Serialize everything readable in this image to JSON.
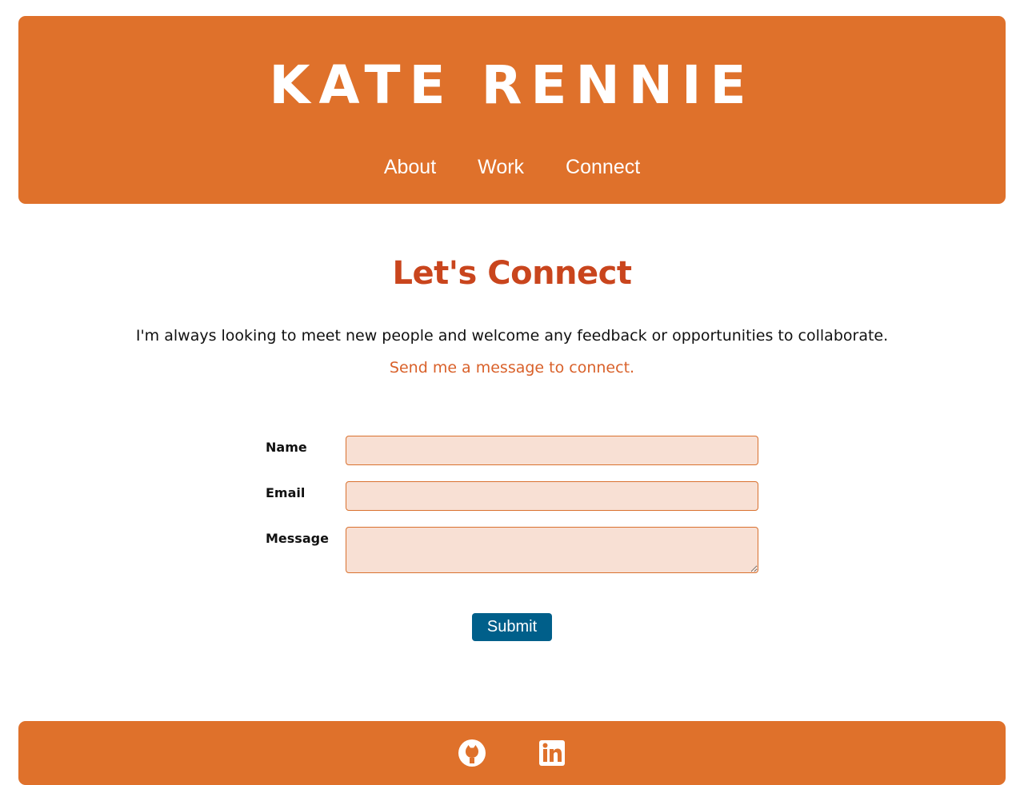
{
  "header": {
    "title": "KATE RENNIE",
    "nav": [
      "About",
      "Work",
      "Connect"
    ]
  },
  "main": {
    "heading": "Let's Connect",
    "intro": "I'm always looking to meet new people and welcome any feedback or opportunities to collaborate.",
    "cta": "Send me a message to connect."
  },
  "form": {
    "name_label": "Name",
    "name_value": "",
    "email_label": "Email",
    "email_value": "",
    "message_label": "Message",
    "message_value": "",
    "submit_label": "Submit"
  },
  "footer": {
    "icons": [
      "github-icon",
      "linkedin-icon"
    ]
  },
  "colors": {
    "brand_orange": "#df712b",
    "heading_red": "#c9451d",
    "field_bg": "#f8e0d4",
    "submit_blue": "#005f8a"
  }
}
